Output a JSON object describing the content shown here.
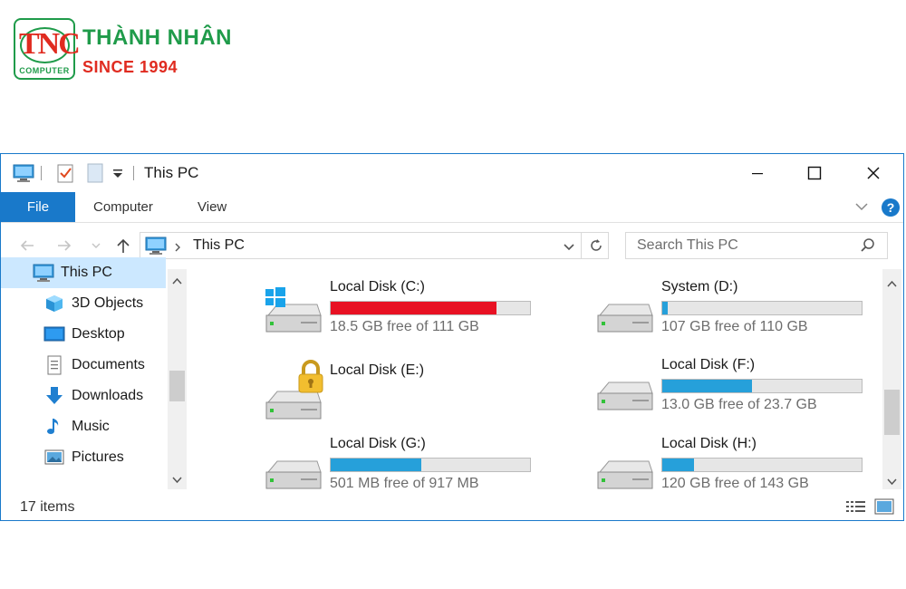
{
  "logo": {
    "badge": "TNC",
    "badge_sub": "COMPUTER",
    "name": "THÀNH NHÂN",
    "since": "SINCE 1994"
  },
  "window": {
    "title": "This PC"
  },
  "ribbon": {
    "tabs": [
      "File",
      "Computer",
      "View"
    ]
  },
  "address": {
    "path": "This PC",
    "search_placeholder": "Search This PC"
  },
  "nav": {
    "items": [
      {
        "label": "This PC",
        "icon": "this-pc-icon"
      },
      {
        "label": "3D Objects",
        "icon": "3d-objects-icon"
      },
      {
        "label": "Desktop",
        "icon": "desktop-icon"
      },
      {
        "label": "Documents",
        "icon": "documents-icon"
      },
      {
        "label": "Downloads",
        "icon": "downloads-icon"
      },
      {
        "label": "Music",
        "icon": "music-icon"
      },
      {
        "label": "Pictures",
        "icon": "pictures-icon"
      }
    ]
  },
  "drives": [
    {
      "name": "Local Disk (C:)",
      "free_text": "18.5 GB free of 111 GB",
      "used_fraction": 0.833,
      "bar_color": "#e81123",
      "badge": "windows"
    },
    {
      "name": "System (D:)",
      "free_text": "107 GB free of 110 GB",
      "used_fraction": 0.027,
      "bar_color": "#26a0da",
      "badge": ""
    },
    {
      "name": "Local Disk (E:)",
      "free_text": "",
      "used_fraction": null,
      "bar_color": "",
      "badge": "lock"
    },
    {
      "name": "Local Disk (F:)",
      "free_text": "13.0 GB free of 23.7 GB",
      "used_fraction": 0.451,
      "bar_color": "#26a0da",
      "badge": ""
    },
    {
      "name": "Local Disk (G:)",
      "free_text": "501 MB free of 917 MB",
      "used_fraction": 0.454,
      "bar_color": "#26a0da",
      "badge": ""
    },
    {
      "name": "Local Disk (H:)",
      "free_text": "120 GB free of 143 GB",
      "used_fraction": 0.161,
      "bar_color": "#26a0da",
      "badge": ""
    }
  ],
  "status": {
    "items_text": "17 items"
  },
  "colors": {
    "accent": "#1979ca",
    "selected": "#cce8ff",
    "bar_critical": "#e81123",
    "bar_normal": "#26a0da"
  }
}
